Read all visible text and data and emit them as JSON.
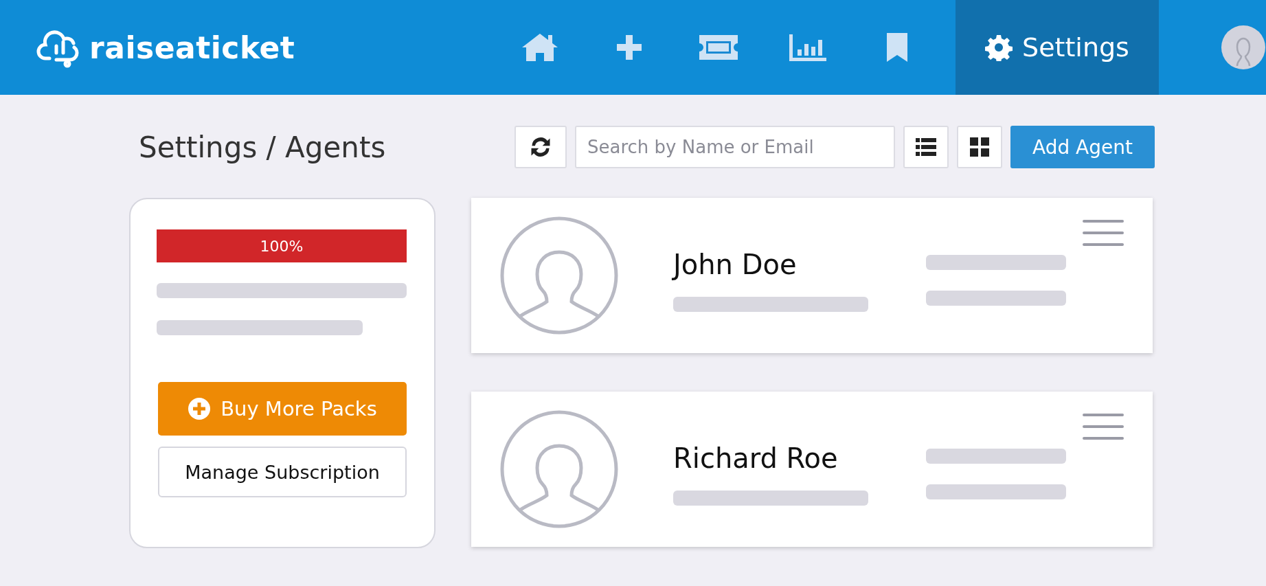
{
  "header": {
    "logo": "raiseaticket",
    "nav": [
      {
        "kind": "home",
        "selected": false
      },
      {
        "kind": "add",
        "selected": false
      },
      {
        "kind": "ticket",
        "selected": false
      },
      {
        "kind": "reports",
        "selected": false
      },
      {
        "kind": "bookmark",
        "selected": false
      },
      {
        "kind": "settings",
        "label": "Settings",
        "selected": true
      }
    ]
  },
  "page": {
    "title": "Settings / Agents",
    "search": {
      "placeholder": "Search by Name or Email"
    },
    "views": [
      {
        "kind": "list",
        "selected": false
      },
      {
        "kind": "grid",
        "selected": false
      }
    ],
    "add_button": "Add Agent"
  },
  "subscription": {
    "usage": {
      "level": 1.0,
      "reading": "100%"
    },
    "buy_button": "Buy More Packs",
    "manage_button": "Manage Subscription"
  },
  "agents": [
    {
      "name": "John Doe"
    },
    {
      "name": "Richard Roe"
    }
  ]
}
